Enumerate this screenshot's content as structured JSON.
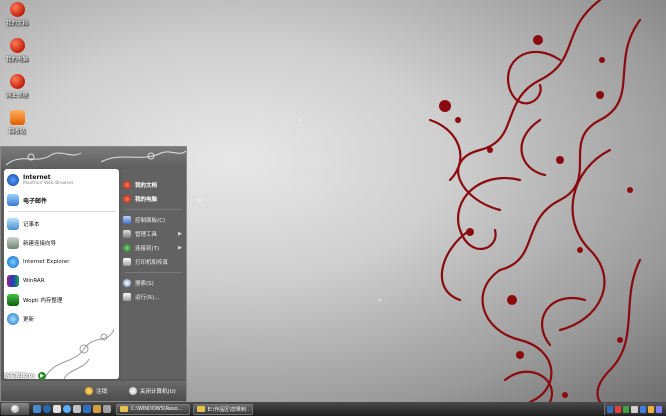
{
  "desktop": {
    "icons": [
      {
        "label": "我的文档",
        "icon": "my-documents-icon"
      },
      {
        "label": "我的电脑",
        "icon": "my-computer-icon"
      },
      {
        "label": "网上邻居",
        "icon": "network-places-icon"
      },
      {
        "label": "回收站",
        "icon": "recycle-bin-icon"
      }
    ]
  },
  "start_menu": {
    "pinned": [
      {
        "title": "Internet",
        "subtitle": "Maxthon Web Browser",
        "icon": "maxthon-icon"
      },
      {
        "title": "电子邮件",
        "subtitle": "",
        "icon": "email-icon"
      }
    ],
    "recent": [
      {
        "label": "记事本",
        "icon": "notepad-icon"
      },
      {
        "label": "新建连接向导",
        "icon": "connection-wizard-icon"
      },
      {
        "label": "Internet Explorer",
        "icon": "internet-explorer-icon"
      },
      {
        "label": "WinRAR",
        "icon": "winrar-icon"
      },
      {
        "label": "Wopti 内存整理",
        "icon": "wopti-memory-icon"
      },
      {
        "label": "更新",
        "icon": "update-icon"
      }
    ],
    "all_programs": "所有程序(P)",
    "right": [
      {
        "label": "我的文档",
        "icon": "my-documents-icon",
        "bold": true,
        "arrow": false
      },
      {
        "label": "我的电脑",
        "icon": "my-computer-icon",
        "bold": true,
        "arrow": false
      },
      {
        "label": "控制面板(C)",
        "icon": "control-panel-icon",
        "bold": false,
        "arrow": false
      },
      {
        "label": "管理工具",
        "icon": "admin-tools-icon",
        "bold": false,
        "arrow": true
      },
      {
        "label": "连接到(T)",
        "icon": "connect-to-icon",
        "bold": false,
        "arrow": true
      },
      {
        "label": "打印机和传真",
        "icon": "printers-icon",
        "bold": false,
        "arrow": false
      },
      {
        "label": "搜索(S)",
        "icon": "search-icon",
        "bold": false,
        "arrow": false
      },
      {
        "label": "运行(R)...",
        "icon": "run-icon",
        "bold": false,
        "arrow": false
      }
    ],
    "footer": {
      "logoff": "注销",
      "shutdown": "关闭计算机(U)"
    }
  },
  "taskbar": {
    "tasks": [
      {
        "label": "C:\\WINDOWS\\Reso..."
      },
      {
        "label": "E:\\作品区\\您果刺..."
      }
    ]
  },
  "colors": {
    "floral": "#8b0a0e",
    "menu_bg": "#5b5b5b",
    "taskbar": "#2a2a2a"
  }
}
